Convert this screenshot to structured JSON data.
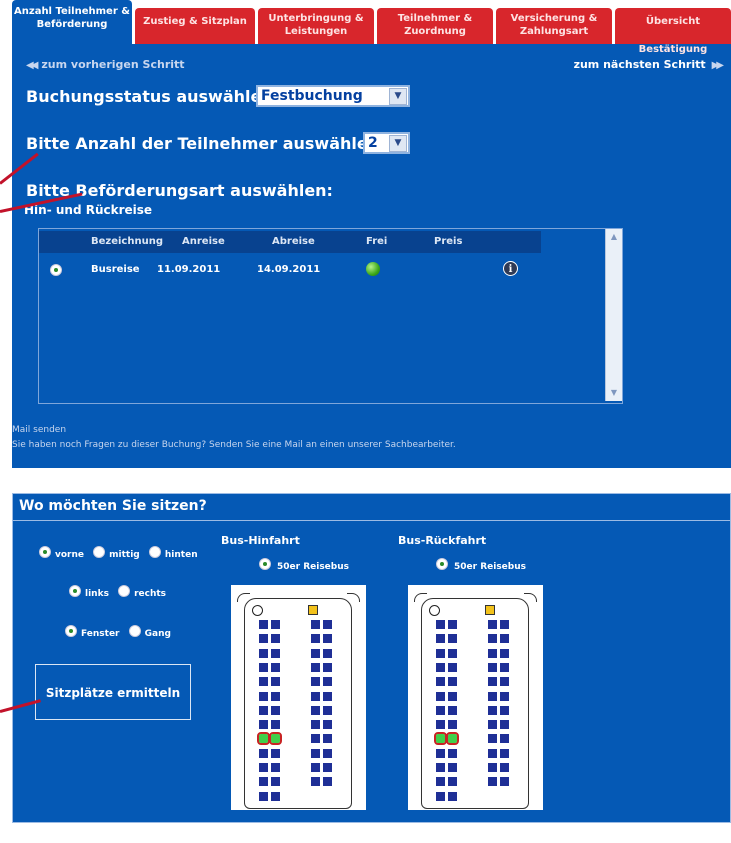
{
  "tabs": [
    {
      "label": "Anzahl Teilnehmer & Beförderung",
      "active": true
    },
    {
      "label": "Zustieg & Sitzplan",
      "active": false
    },
    {
      "label": "Unterbringung & Leistungen",
      "active": false
    },
    {
      "label": "Teilnehmer & Zuordnung",
      "active": false
    },
    {
      "label": "Versicherung & Zahlungsart",
      "active": false
    },
    {
      "label": "Übersicht Bestätigung",
      "active": false
    }
  ],
  "nav": {
    "prev": "zum vorherigen Schritt",
    "next": "zum nächsten Schritt"
  },
  "booking_status": {
    "label": "Buchungsstatus auswählen:",
    "value": "Festbuchung"
  },
  "participants": {
    "label": "Bitte Anzahl der Teilnehmer auswählen:",
    "value": "2"
  },
  "transport": {
    "label": "Bitte Beförderungsart auswählen:",
    "sub": "Hin- und Rückreise"
  },
  "table": {
    "columns": [
      "Bezeichnung",
      "Anreise",
      "Abreise",
      "Frei",
      "Preis"
    ],
    "rows": [
      {
        "name": "Busreise",
        "arrival": "11.09.2011",
        "departure": "14.09.2011",
        "free": "green",
        "price": ""
      }
    ]
  },
  "mail": {
    "link": "Mail senden",
    "text": "Sie haben noch Fragen zu dieser Buchung? Senden Sie eine Mail an einen unserer Sachbearbeiter."
  },
  "seating": {
    "title": "Wo möchten Sie sitzen?",
    "position": [
      "vorne",
      "mittig",
      "hinten"
    ],
    "position_selected": "vorne",
    "side": [
      "links",
      "rechts"
    ],
    "side_selected": "links",
    "seat_type": [
      "Fenster",
      "Gang"
    ],
    "seat_type_selected": "Fenster",
    "button": "Sitzplätze ermitteln",
    "outbound": {
      "title": "Bus-Hinfahrt",
      "bus": "50er Reisebus"
    },
    "return": {
      "title": "Bus-Rückfahrt",
      "bus": "50er Reisebus"
    }
  },
  "colors": {
    "panel": "#0559b5",
    "tab_inactive": "#d8262c",
    "seat": "#1f2f96",
    "seat_selected": "#3fd04a",
    "annotation_arrow": "#c2122a"
  }
}
